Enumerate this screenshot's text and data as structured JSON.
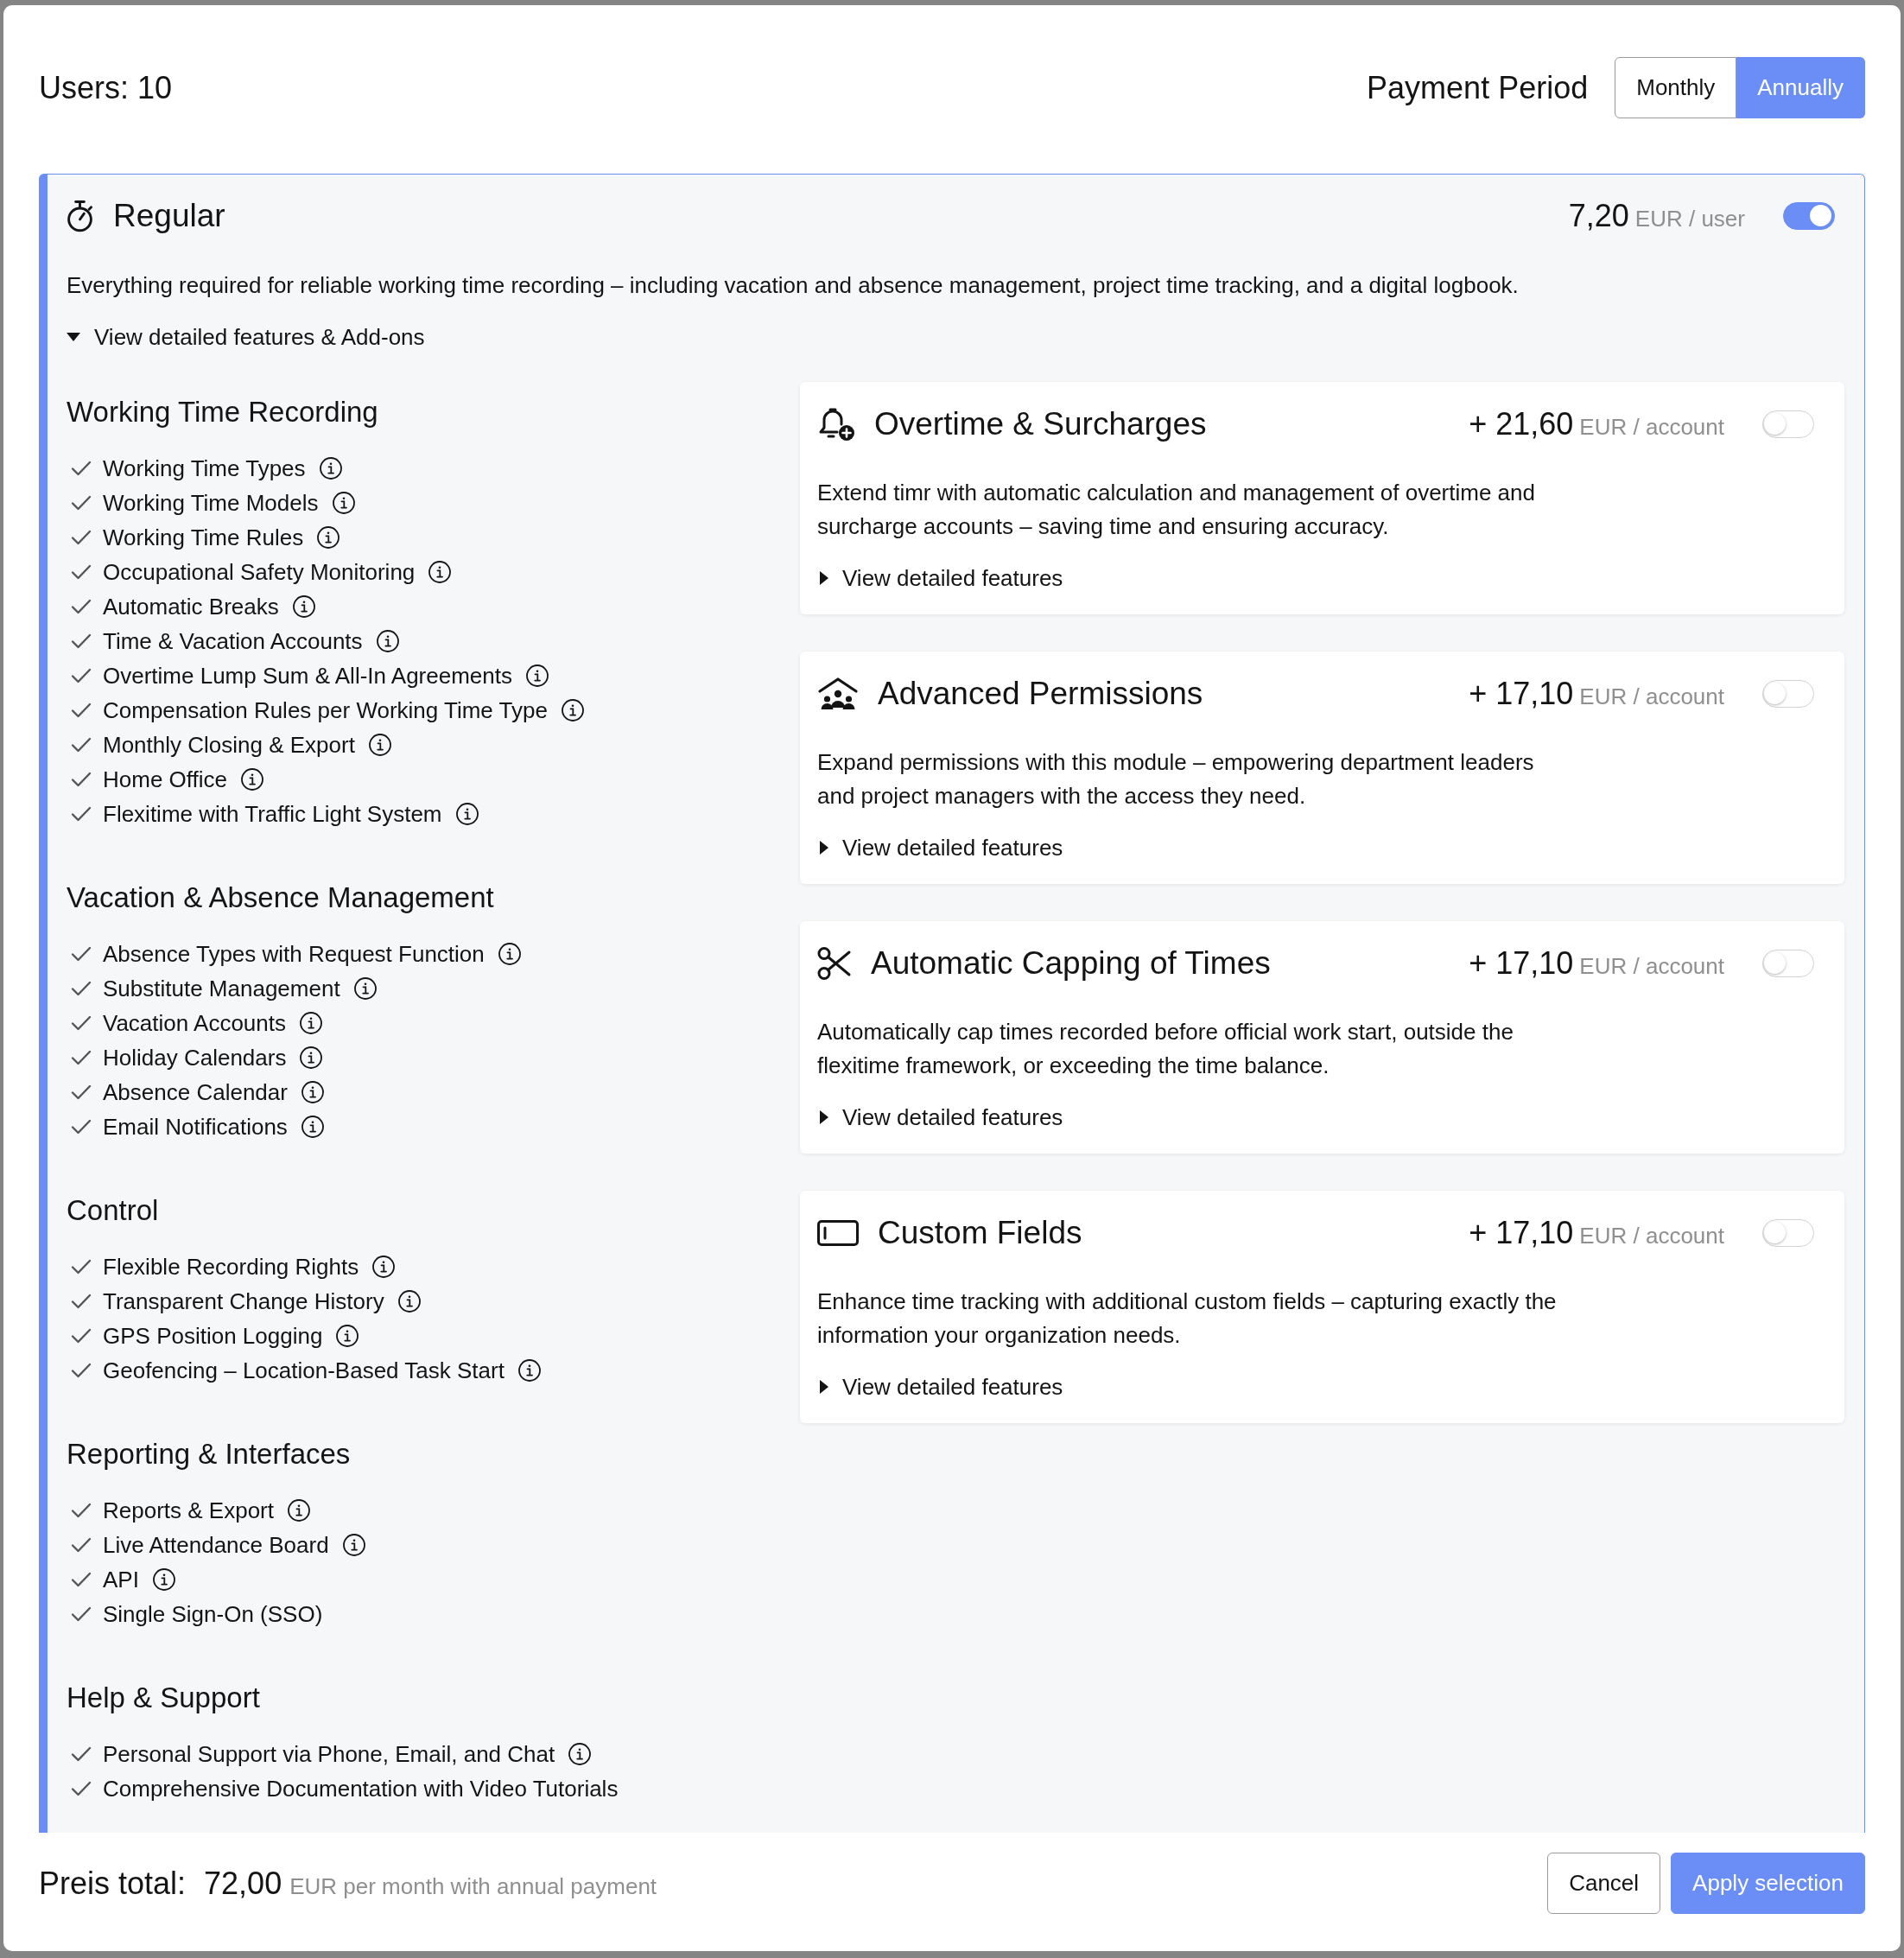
{
  "header": {
    "users_label": "Users: 10",
    "payment_period": {
      "label": "Payment Period",
      "options": [
        {
          "label": "Monthly",
          "selected": false
        },
        {
          "label": "Annually",
          "selected": true
        }
      ]
    }
  },
  "plan": {
    "title": "Regular",
    "price": "7,20",
    "unit": "EUR / user",
    "on": true,
    "description": "Everything required for reliable working time recording – including vacation and absence management, project time tracking, and a digital logbook.",
    "details_link": {
      "label": "View detailed features & Add-ons",
      "expanded": true
    }
  },
  "feature_sections": [
    {
      "title": "Working Time Recording",
      "items": [
        {
          "label": "Working Time Types",
          "info": true
        },
        {
          "label": "Working Time Models",
          "info": true
        },
        {
          "label": "Working Time Rules",
          "info": true
        },
        {
          "label": "Occupational Safety Monitoring",
          "info": true
        },
        {
          "label": "Automatic Breaks",
          "info": true
        },
        {
          "label": "Time & Vacation Accounts",
          "info": true
        },
        {
          "label": "Overtime Lump Sum & All-In Agreements",
          "info": true
        },
        {
          "label": "Compensation Rules per Working Time Type",
          "info": true
        },
        {
          "label": "Monthly Closing & Export",
          "info": true
        },
        {
          "label": "Home Office",
          "info": true
        },
        {
          "label": "Flexitime with Traffic Light System",
          "info": true
        }
      ]
    },
    {
      "title": "Vacation & Absence Management",
      "items": [
        {
          "label": "Absence Types with Request Function",
          "info": true
        },
        {
          "label": "Substitute Management",
          "info": true
        },
        {
          "label": "Vacation Accounts",
          "info": true
        },
        {
          "label": "Holiday Calendars",
          "info": true
        },
        {
          "label": "Absence Calendar",
          "info": true
        },
        {
          "label": "Email Notifications",
          "info": true
        }
      ]
    },
    {
      "title": "Control",
      "items": [
        {
          "label": "Flexible Recording Rights",
          "info": true
        },
        {
          "label": "Transparent Change History",
          "info": true
        },
        {
          "label": "GPS Position Logging",
          "info": true
        },
        {
          "label": "Geofencing – Location-Based Task Start",
          "info": true
        }
      ]
    },
    {
      "title": "Reporting & Interfaces",
      "items": [
        {
          "label": "Reports & Export",
          "info": true
        },
        {
          "label": "Live Attendance Board",
          "info": true
        },
        {
          "label": "API",
          "info": true
        },
        {
          "label": "Single Sign-On (SSO)",
          "info": false
        }
      ]
    },
    {
      "title": "Help & Support",
      "items": [
        {
          "label": "Personal Support via Phone, Email, and Chat",
          "info": true
        },
        {
          "label": "Comprehensive Documentation with Video Tutorials",
          "info": false
        }
      ]
    }
  ],
  "addons": [
    {
      "title": "Overtime & Surcharges",
      "price": "+ 21,60",
      "unit": "EUR / account",
      "on": false,
      "description": "Extend timr with automatic calculation and management of overtime and surcharge accounts – saving time and ensuring accuracy.",
      "details_link": {
        "label": "View detailed features",
        "expanded": false
      }
    },
    {
      "title": "Advanced Permissions",
      "price": "+ 17,10",
      "unit": "EUR / account",
      "on": false,
      "description": "Expand permissions with this module – empowering department leaders and project managers with the access they need.",
      "details_link": {
        "label": "View detailed features",
        "expanded": false
      }
    },
    {
      "title": "Automatic Capping of Times",
      "price": "+ 17,10",
      "unit": "EUR / account",
      "on": false,
      "description": "Automatically cap times recorded before official work start, outside the flexitime framework, or exceeding the time balance.",
      "details_link": {
        "label": "View detailed features",
        "expanded": false
      }
    },
    {
      "title": "Custom Fields",
      "price": "+ 17,10",
      "unit": "EUR / account",
      "on": false,
      "description": "Enhance time tracking with additional custom fields – capturing exactly the information your organization needs.",
      "details_link": {
        "label": "View detailed features",
        "expanded": false
      }
    }
  ],
  "footer": {
    "total_label": "Preis total:",
    "total": "72,00",
    "total_note": "EUR per month with annual payment",
    "buttons": [
      {
        "label": "Cancel",
        "kind": "secondary"
      },
      {
        "label": "Apply selection",
        "kind": "primary"
      }
    ]
  }
}
